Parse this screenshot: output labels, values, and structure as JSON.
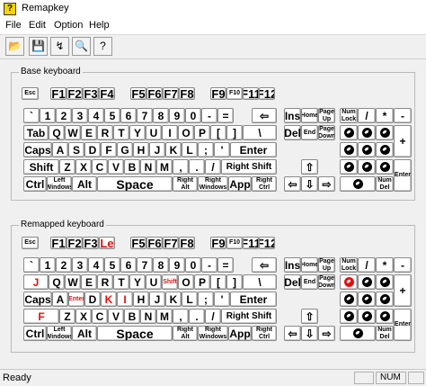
{
  "window": {
    "title": "Remapkey"
  },
  "menu": [
    "File",
    "Edit",
    "Option",
    "Help"
  ],
  "toolbar": [
    {
      "name": "open-icon",
      "glyph": "📂"
    },
    {
      "name": "save-icon",
      "glyph": "💾"
    },
    {
      "name": "remap-icon",
      "glyph": "↯"
    },
    {
      "name": "view-icon",
      "glyph": "🔍"
    },
    {
      "name": "help-icon",
      "glyph": "?"
    }
  ],
  "base": {
    "title": "Base keyboard",
    "keys": {
      "esc": "Esc",
      "f1": "F1",
      "f2": "F2",
      "f3": "F3",
      "f4": "F4",
      "f5": "F5",
      "f6": "F6",
      "f7": "F7",
      "f8": "F8",
      "f9": "F9",
      "f10": "F10",
      "f11": "F11",
      "f12": "F12",
      "grave": "`",
      "d1": "1",
      "d2": "2",
      "d3": "3",
      "d4": "4",
      "d5": "5",
      "d6": "6",
      "d7": "7",
      "d8": "8",
      "d9": "9",
      "d0": "0",
      "minus": "-",
      "equal": "=",
      "backspace": "⇦",
      "ins": "Ins",
      "home": "Home",
      "pgup": "Page Up",
      "numlock": "Num Lock",
      "npdiv": "/",
      "npmul": "*",
      "npsub": "-",
      "tab": "Tab",
      "q": "Q",
      "w": "W",
      "e": "E",
      "r": "R",
      "t": "T",
      "y": "Y",
      "u": "U",
      "i": "I",
      "o": "O",
      "p": "P",
      "lbr": "[",
      "rbr": "]",
      "bslash": "\\",
      "del": "Del",
      "end": "End",
      "pgdn": "Page Down",
      "npadd": "+",
      "caps": "Caps",
      "a": "A",
      "s": "S",
      "d": "D",
      "f": "F",
      "g": "G",
      "h": "H",
      "j": "J",
      "k": "K",
      "l": "L",
      "semi": ";",
      "quote": "'",
      "enter": "Enter",
      "lshift": "Shift",
      "z": "Z",
      "x": "X",
      "c": "C",
      "v": "V",
      "b": "B",
      "n": "N",
      "m": "M",
      "comma": ",",
      "period": ".",
      "slash": "/",
      "rshift": "Right Shift",
      "up": "⇧",
      "npenter": "Enter",
      "lctrl": "Ctrl",
      "lwin": "Left Windows",
      "lalt": "Alt",
      "space": "Space",
      "ralt": "Right Alt",
      "rwin": "Right Windows",
      "app": "App",
      "rctrl": "Right Ctrl",
      "left": "⇦",
      "down": "⇩",
      "right": "⇨",
      "npdel": "Num Del"
    }
  },
  "remapped": {
    "title": "Remapped keyboard",
    "keys": {
      "esc": "Esc",
      "f1": "F1",
      "f2": "F2",
      "f3": "F3",
      "f4": "Le",
      "f5": "F5",
      "f6": "F6",
      "f7": "F7",
      "f8": "F8",
      "f9": "F9",
      "f10": "F10",
      "f11": "F11",
      "f12": "F12",
      "grave": "`",
      "d1": "1",
      "d2": "2",
      "d3": "3",
      "d4": "4",
      "d5": "5",
      "d6": "6",
      "d7": "7",
      "d8": "8",
      "d9": "9",
      "d0": "0",
      "minus": "-",
      "equal": "=",
      "backspace": "⇦",
      "ins": "Ins",
      "home": "Home",
      "pgup": "Page Up",
      "numlock": "Num Lock",
      "npdiv": "/",
      "npmul": "*",
      "npsub": "-",
      "tab": "J",
      "q": "Q",
      "w": "W",
      "e": "E",
      "r": "R",
      "t": "T",
      "y": "Y",
      "u": "U",
      "i": "Shift",
      "o": "O",
      "p": "P",
      "lbr": "[",
      "rbr": "]",
      "bslash": "\\",
      "del": "Del",
      "end": "End",
      "pgdn": "Page Down",
      "npadd": "+",
      "caps": "Caps",
      "a": "A",
      "s": "Enter",
      "d": "D",
      "f": "K",
      "g": "I",
      "h": "H",
      "j": "J",
      "k": "K",
      "l": "L",
      "semi": ";",
      "quote": "'",
      "enter": "Enter",
      "lshift": "F",
      "z": "Z",
      "x": "X",
      "c": "C",
      "v": "V",
      "b": "B",
      "n": "N",
      "m": "M",
      "comma": ",",
      "period": ".",
      "slash": "/",
      "rshift": "Right Shift",
      "up": "⇧",
      "npenter": "Enter",
      "lctrl": "Ctrl",
      "lwin": "Left Windows",
      "lalt": "Alt",
      "space": "Space",
      "ralt": "Right Alt",
      "rwin": "Right Windows",
      "app": "App",
      "rctrl": "Right Ctrl",
      "left": "⇦",
      "down": "⇩",
      "right": "⇨",
      "npdel": "Num Del"
    },
    "remapped_keys": [
      "f4",
      "tab",
      "s",
      "f",
      "g",
      "i",
      "lshift",
      "np7"
    ]
  },
  "status": {
    "text": "Ready",
    "num": "NUM"
  }
}
